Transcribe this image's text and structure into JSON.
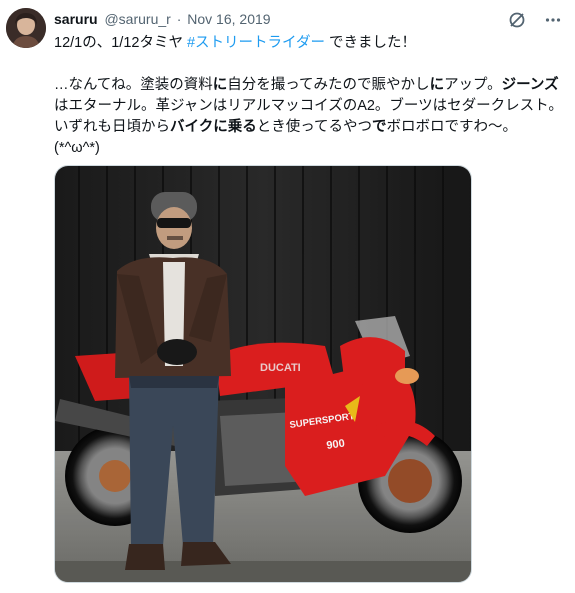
{
  "tweet": {
    "display_name": "saruru",
    "handle": "@saruru_r",
    "separator": "·",
    "date": "Nov 16, 2019",
    "line1_prefix": "12/1の、1/12タミヤ ",
    "hashtag": "#ストリートライダー",
    "line1_suffix": " できました！",
    "p2_a": "…なんてね。塗装の資料",
    "p2_b": "に",
    "p2_c": "自分を撮ってみたので賑やかし",
    "p2_d": "に",
    "p2_e": "アップ。",
    "p2_f": "ジーンズ",
    "p2_g": "はエターナル。革ジャンはリアルマッコイズのA2。ブーツはセダークレスト。いずれも日頃から",
    "p2_h": "バイクに乗る",
    "p2_i": "とき使ってるやつ",
    "p2_j": "で",
    "p2_k": "ボロボロですわ〜。",
    "p2_l": "(*^ω^*)"
  },
  "media": {
    "alt": "Man in leather jacket and jeans standing beside a red Ducati 900 SuperSport motorcycle in front of a dark wooden wall",
    "fairing_text": "SUPERSPORT",
    "fairing_number": "900",
    "tank_text": "DUCATI"
  },
  "icons": {
    "grok": "grok-slash-icon",
    "more": "more-dots-icon"
  }
}
